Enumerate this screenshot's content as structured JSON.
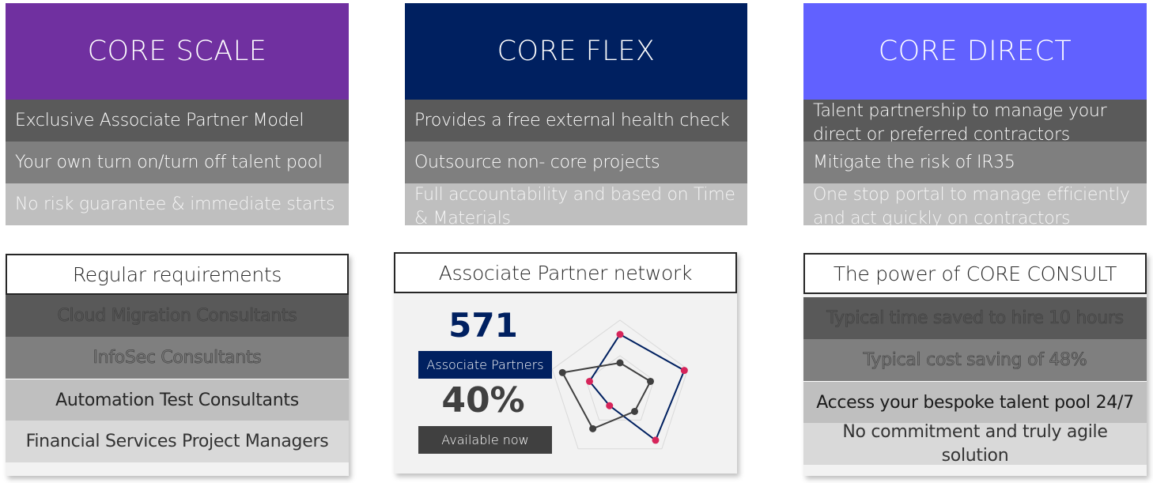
{
  "services": [
    {
      "title": "CORE SCALE",
      "color": "#7030a0",
      "features": [
        "Exclusive Associate Partner Model",
        "Your own turn on/turn off talent pool",
        "No risk guarantee & immediate starts"
      ]
    },
    {
      "title": "CORE FLEX",
      "color": "#002060",
      "features": [
        "Provides a free external health check",
        "Outsource non- core projects",
        "Full accountability and based on Time & Materials"
      ]
    },
    {
      "title": "CORE DIRECT",
      "color": "#6161ff",
      "features": [
        "Talent partnership to manage your direct or preferred contractors",
        "Mitigate the risk of IR35",
        "One stop portal to manage efficiently and act quickly on contractors"
      ]
    }
  ],
  "requirements": {
    "title": "Regular requirements",
    "items": [
      "Cloud Migration Consultants",
      "InfoSec Consultants",
      "Automation Test Consultants",
      "Financial Services Project Managers"
    ]
  },
  "network": {
    "title": "Associate Partner network",
    "partners_count": "571",
    "partners_label": "Associate Partners",
    "available_pct": "40%",
    "available_label": "Available now",
    "count_color": "#002060",
    "radar": {
      "axes": 5,
      "max": 1.0,
      "grid_levels": [
        0.5,
        1.0
      ],
      "series": [
        {
          "name": "navy",
          "line_color": "#002060",
          "marker_color": "#d6245a",
          "values": [
            0.8,
            0.95,
            0.85,
            0.25,
            0.45
          ]
        },
        {
          "name": "grey",
          "line_color": "#404040",
          "marker_color": "#404040",
          "values": [
            0.4,
            0.45,
            0.35,
            0.65,
            0.85
          ]
        }
      ]
    }
  },
  "power": {
    "title": "The power of CORE CONSULT",
    "items": [
      "Typical time saved to hire 10 hours",
      "Typical cost saving of 48%",
      "Access your bespoke talent pool 24/7",
      "No commitment and truly agile solution"
    ]
  }
}
